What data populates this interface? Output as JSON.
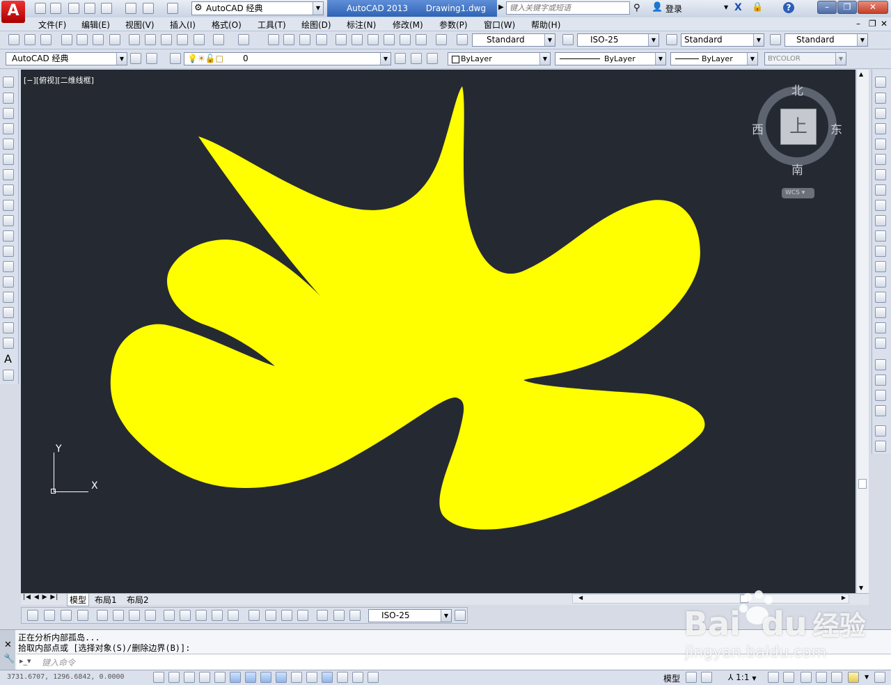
{
  "title_bar": {
    "workspace": "AutoCAD 经典",
    "app_name": "AutoCAD 2013",
    "document": "Drawing1.dwg",
    "search_placeholder": "键入关键字或短语",
    "login": "登录"
  },
  "menu": [
    "文件(F)",
    "编辑(E)",
    "视图(V)",
    "插入(I)",
    "格式(O)",
    "工具(T)",
    "绘图(D)",
    "标注(N)",
    "修改(M)",
    "参数(P)",
    "窗口(W)",
    "帮助(H)"
  ],
  "styles": {
    "text_style": "Standard",
    "dim_style": "ISO-25",
    "table_style": "Standard",
    "multileader_style": "Standard"
  },
  "layers_row": {
    "workspace": "AutoCAD 经典",
    "layer": "0",
    "color": "ByLayer",
    "linetype": "ByLayer",
    "lineweight": "ByLayer",
    "plot_style": "BYCOLOR"
  },
  "viewport": {
    "label": "[−][俯视][二维线框]",
    "background": "#252a32",
    "shape_color": "#ffff00"
  },
  "viewcube": {
    "north": "北",
    "south": "南",
    "east": "东",
    "west": "西",
    "face": "上",
    "wcs": "WCS"
  },
  "ucs": {
    "x": "X",
    "y": "Y"
  },
  "tabs": [
    "模型",
    "布局1",
    "布局2"
  ],
  "dim_toolbar_style": "ISO-25",
  "command": {
    "history_line1": "正在分析内部孤岛...",
    "history_line2": "拾取内部点或 [选择对象(S)/删除边界(B)]:",
    "input_placeholder": "键入命令"
  },
  "status": {
    "coordinates": "3731.6707,  1296.6842,  0.0000",
    "model": "模型",
    "scale": "1:1"
  },
  "watermark": {
    "brand": "Bai",
    "brand2": "du",
    "jingyan": "经验",
    "url": "jingyan.baidu.com"
  }
}
